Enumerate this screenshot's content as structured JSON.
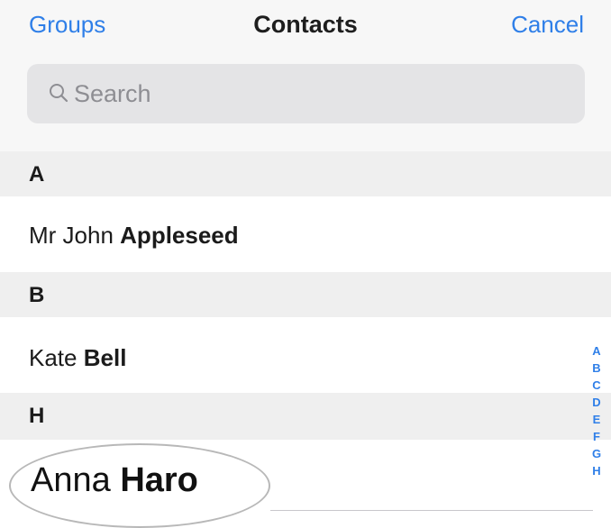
{
  "nav": {
    "left_button": "Groups",
    "title": "Contacts",
    "right_button": "Cancel"
  },
  "search": {
    "placeholder": "Search"
  },
  "sections": [
    {
      "letter": "A",
      "contacts": [
        {
          "first": "Mr John",
          "last": "Appleseed"
        }
      ]
    },
    {
      "letter": "B",
      "contacts": [
        {
          "first": "Kate",
          "last": "Bell"
        }
      ]
    },
    {
      "letter": "H",
      "contacts": [
        {
          "first": "Anna",
          "last": "Haro"
        }
      ]
    }
  ],
  "index_letters": [
    "A",
    "B",
    "C",
    "D",
    "E",
    "F",
    "G",
    "H"
  ],
  "colors": {
    "accent": "#2f7fe8",
    "section_bg": "#efefef",
    "nav_bg": "#f7f7f7"
  }
}
